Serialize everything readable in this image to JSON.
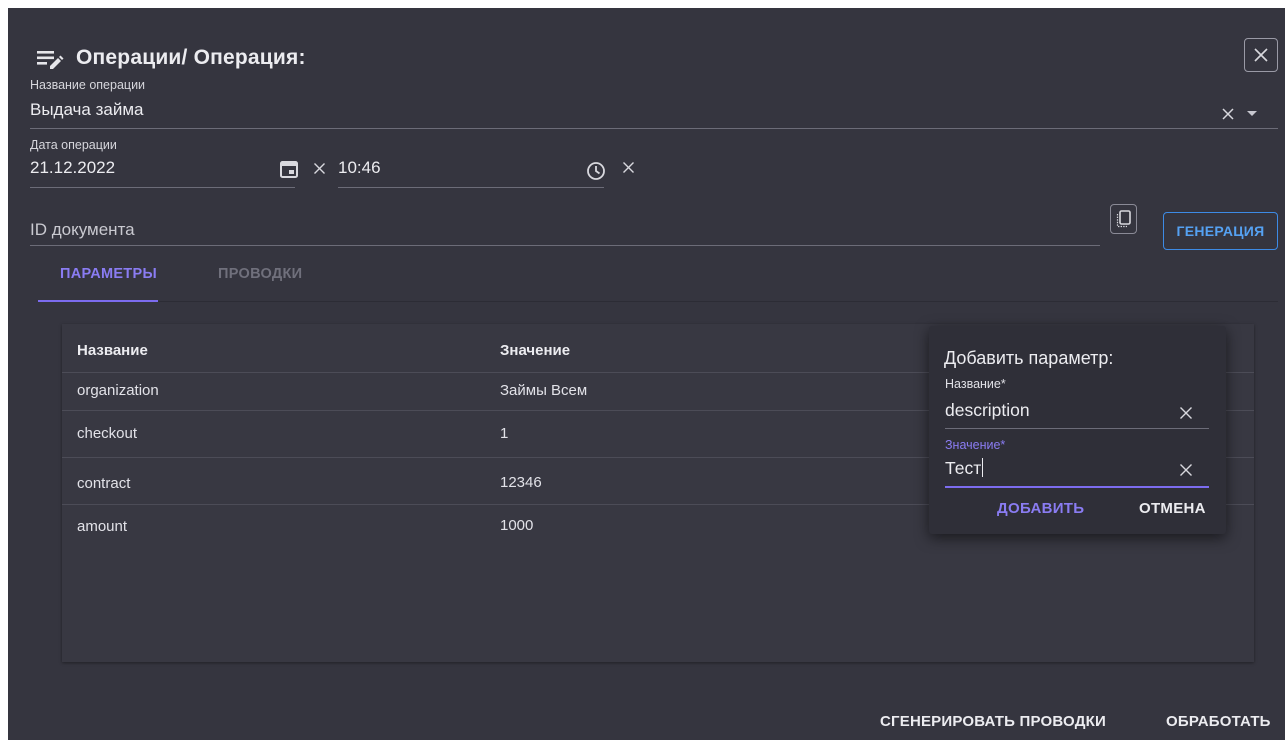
{
  "header": {
    "title": "Операции/ Операция:",
    "icon": "edit-list-icon"
  },
  "operation_name": {
    "label": "Название операции",
    "value": "Выдача займа"
  },
  "operation_date": {
    "label": "Дата операции",
    "date": "21.12.2022",
    "time": "10:46"
  },
  "document_id": {
    "placeholder": "ID документа",
    "generate_label": "ГЕНЕРАЦИЯ"
  },
  "tabs": [
    {
      "label": "ПАРАМЕТРЫ",
      "active": true
    },
    {
      "label": "ПРОВОДКИ",
      "active": false
    }
  ],
  "table": {
    "headers": [
      "Название",
      "Значение"
    ],
    "rows": [
      [
        "organization",
        "Займы Всем"
      ],
      [
        "checkout",
        "1"
      ],
      [
        "contract",
        "12346"
      ],
      [
        "amount",
        "1000"
      ]
    ]
  },
  "add_param": {
    "title": "Добавить параметр:",
    "name_label": "Название*",
    "name_value": "description",
    "value_label": "Значение*",
    "value_value": "Тест",
    "add_label": "ДОБАВИТЬ",
    "cancel_label": "ОТМЕНА"
  },
  "footer": {
    "generate_label": "СГЕНЕРИРОВАТЬ ПРОВОДКИ",
    "process_label": "ОБРАБОТАТЬ"
  },
  "colors": {
    "background": "#35353f",
    "accent": "#7c6cef",
    "link_blue": "#55a1f2",
    "popup": "#2f2f38"
  }
}
